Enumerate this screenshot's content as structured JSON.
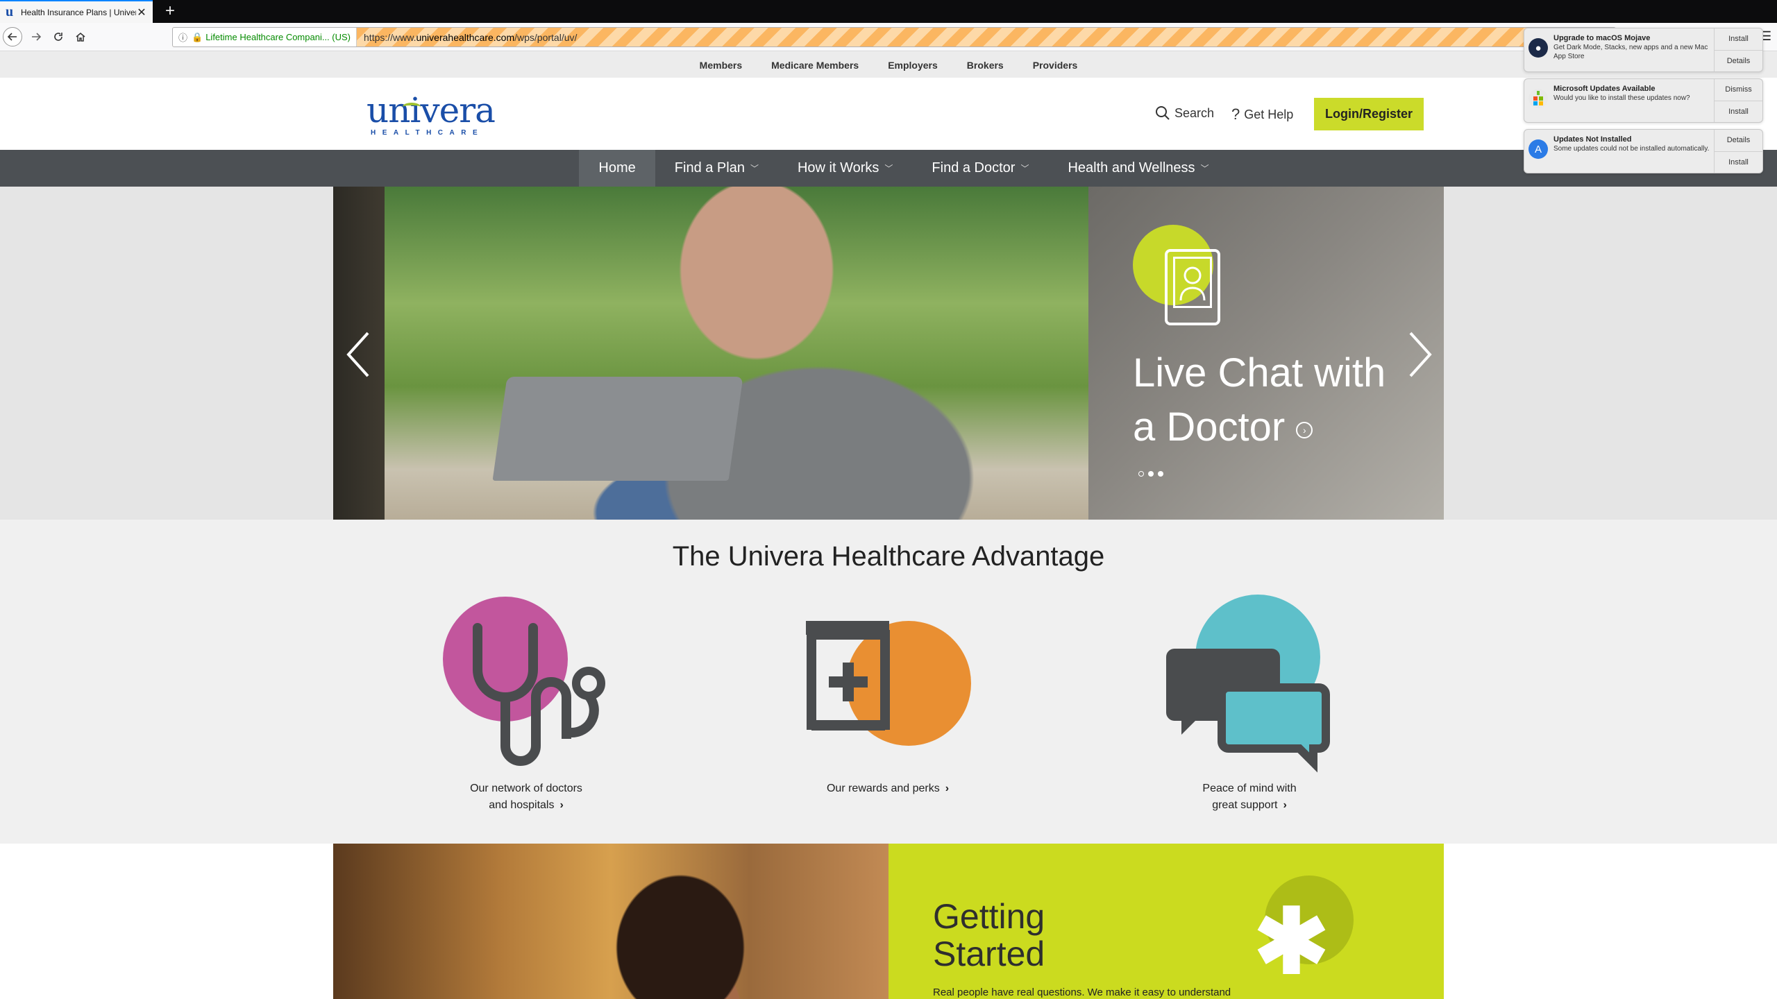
{
  "browser": {
    "tab_title": "Health Insurance Plans | Univer",
    "tab_close": "✕",
    "new_tab": "+",
    "identity": "Lifetime Healthcare Compani... (US)",
    "url_prefix": "https://www.",
    "url_domain": "univerahealthcare.com",
    "url_path": "/wps/portal/uv/",
    "hamburger": "☰"
  },
  "utility_nav": [
    "Members",
    "Medicare Members",
    "Employers",
    "Brokers",
    "Providers"
  ],
  "header": {
    "logo_word": "univera",
    "logo_sub": "HEALTHCARE",
    "search_label": "Search",
    "help_label": "Get Help",
    "login_label": "Login/Register"
  },
  "main_nav": [
    {
      "label": "Home",
      "caret": ""
    },
    {
      "label": "Find a Plan",
      "caret": "﹀"
    },
    {
      "label": "How it Works",
      "caret": "﹀"
    },
    {
      "label": "Find a Doctor",
      "caret": "﹀"
    },
    {
      "label": "Health and Wellness",
      "caret": "﹀"
    }
  ],
  "hero": {
    "title_line1": "Live Chat with",
    "title_line2": "a Doctor",
    "prev": "‹",
    "next": "›",
    "circle_arrow": "›",
    "active_slide": 1,
    "slide_count": 3
  },
  "advantage": {
    "title": "The Univera Healthcare Advantage",
    "features": [
      {
        "line1": "Our network of doctors",
        "line2": "and hospitals",
        "chev": "›",
        "color": "#c2569d"
      },
      {
        "line1": "Our rewards and perks",
        "line2": "",
        "chev": "›",
        "color": "#e98f32"
      },
      {
        "line1": "Peace of mind with",
        "line2": "great support",
        "chev": "›",
        "color": "#5ec0ca"
      }
    ]
  },
  "getting_started": {
    "title_line1": "Getting",
    "title_line2": "Started",
    "text": "Real people have real questions. We make it easy to understand",
    "asterisk": "✱"
  },
  "notifications": [
    {
      "title": "Upgrade to macOS Mojave",
      "text": "Get Dark Mode, Stacks, new apps and a new Mac App Store",
      "btn1": "Install",
      "btn2": "Details",
      "icon": "macos-icon",
      "icon_color": "#1c2a48"
    },
    {
      "title": "Microsoft Updates Available",
      "text": "Would you like to install these updates now?",
      "btn1": "Dismiss",
      "btn2": "Install",
      "icon": "microsoft-update-icon",
      "icon_color": "#e9e9e9"
    },
    {
      "title": "Updates Not Installed",
      "text": "Some updates could not be installed automatically.",
      "btn1": "Details",
      "btn2": "Install",
      "icon": "app-store-icon",
      "icon_color": "#2b7be6"
    }
  ],
  "colors": {
    "brand_blue": "#1a4ea8",
    "lime": "#cbdb2a",
    "nav_gray": "#4c5054"
  }
}
